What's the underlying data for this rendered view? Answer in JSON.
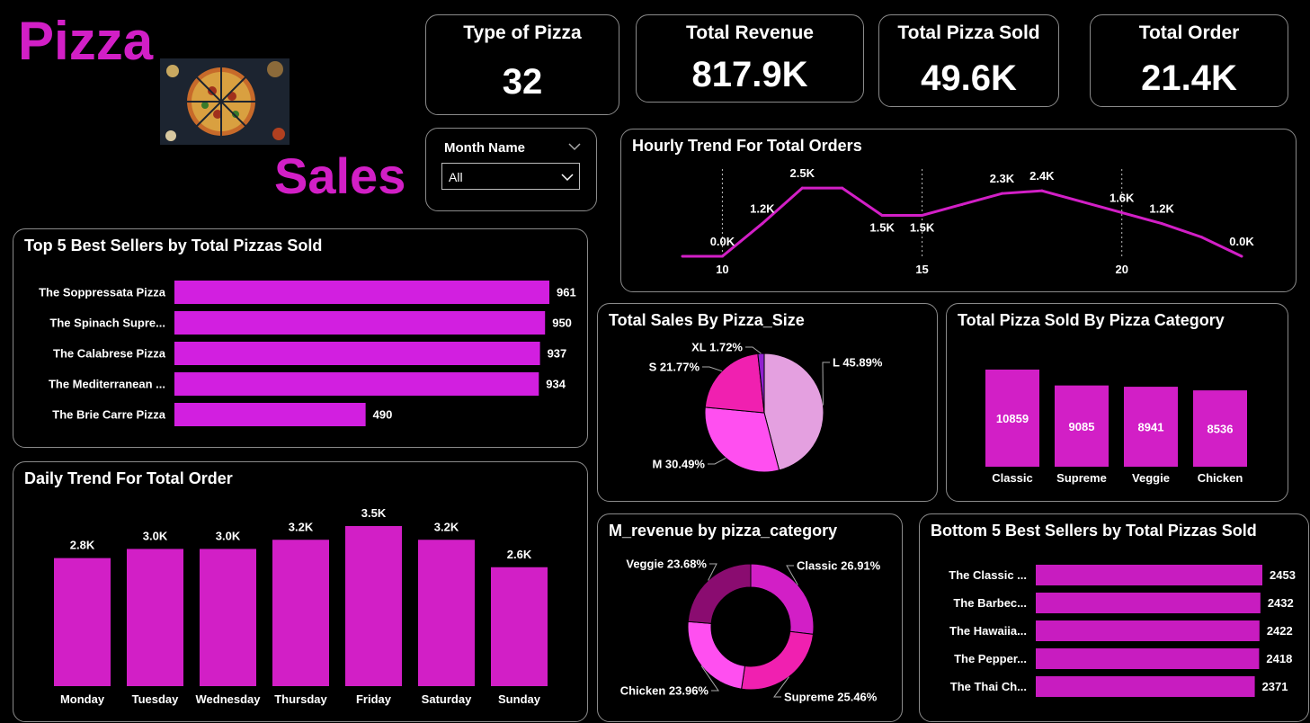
{
  "brand": {
    "title": "Pizza",
    "subtitle": "Sales",
    "image_icon": "pizza-photo"
  },
  "colors": {
    "background": "#000000",
    "accent": "#d21fc6",
    "border": "#8a8a8a"
  },
  "kpis": [
    {
      "title": "Type of Pizza",
      "value": "32"
    },
    {
      "title": "Total Revenue",
      "value": "817.9K"
    },
    {
      "title": "Total Pizza Sold",
      "value": "49.6K"
    },
    {
      "title": "Total Order",
      "value": "21.4K"
    }
  ],
  "slicer": {
    "label": "Month Name",
    "value": "All",
    "icon": "chevron-down-icon"
  },
  "chart_data": [
    {
      "id": "hourly",
      "type": "line",
      "title": "Hourly Trend For Total Orders",
      "x": [
        9,
        10,
        11,
        12,
        13,
        14,
        15,
        16,
        17,
        18,
        19,
        20,
        21,
        22,
        23
      ],
      "values": [
        0.0,
        0.0,
        1.2,
        2.5,
        2.5,
        1.5,
        1.5,
        1.9,
        2.3,
        2.4,
        2.0,
        1.6,
        1.2,
        0.7,
        0.0
      ],
      "labels": [
        {
          "i": 1,
          "text": "0.0K"
        },
        {
          "i": 2,
          "text": "1.2K"
        },
        {
          "i": 3,
          "text": "2.5K"
        },
        {
          "i": 5,
          "text": "1.5K"
        },
        {
          "i": 6,
          "text": "1.5K"
        },
        {
          "i": 8,
          "text": "2.3K"
        },
        {
          "i": 9,
          "text": "2.4K"
        },
        {
          "i": 11,
          "text": "1.6K"
        },
        {
          "i": 12,
          "text": "1.2K"
        },
        {
          "i": 14,
          "text": "0.0K"
        }
      ],
      "xticks": [
        10,
        15,
        20
      ],
      "ylim": [
        0,
        2.8
      ],
      "color": "#d21fc6"
    },
    {
      "id": "top5",
      "type": "bar",
      "orientation": "horizontal",
      "title": "Top 5 Best Sellers by Total Pizzas Sold",
      "categories": [
        "The Soppressata Pizza",
        "The Spinach Supre...",
        "The Calabrese Pizza",
        "The Mediterranean ...",
        "The Brie Carre Pizza"
      ],
      "values": [
        961,
        950,
        937,
        934,
        490
      ],
      "xlim": [
        0,
        961
      ],
      "color": "#d21fe0"
    },
    {
      "id": "daily",
      "type": "bar",
      "title": "Daily Trend For Total Order",
      "categories": [
        "Monday",
        "Tuesday",
        "Wednesday",
        "Thursday",
        "Friday",
        "Saturday",
        "Sunday"
      ],
      "values": [
        2.8,
        3.0,
        3.0,
        3.2,
        3.5,
        3.2,
        2.6
      ],
      "value_labels": [
        "2.8K",
        "3.0K",
        "3.0K",
        "3.2K",
        "3.5K",
        "3.2K",
        "2.6K"
      ],
      "ylim": [
        0,
        3.5
      ],
      "color": "#d21fc6"
    },
    {
      "id": "size",
      "type": "pie",
      "title": "Total Sales By Pizza_Size",
      "categories": [
        "L",
        "M",
        "S",
        "XL"
      ],
      "values": [
        45.89,
        30.49,
        21.77,
        1.72
      ],
      "labels": [
        "L 45.89%",
        "M 30.49%",
        "S 21.77%",
        "XL 1.72%"
      ],
      "colors": [
        "#e4a0e0",
        "#ff4ff0",
        "#f020b0",
        "#9020d0"
      ]
    },
    {
      "id": "category",
      "type": "bar",
      "title": "Total Pizza Sold By Pizza Category",
      "categories": [
        "Classic",
        "Supreme",
        "Veggie",
        "Chicken"
      ],
      "values": [
        10859,
        9085,
        8941,
        8536
      ],
      "ylim": [
        0,
        10859
      ],
      "color": "#d21fc6"
    },
    {
      "id": "revenue",
      "type": "pie",
      "title": "M_revenue by pizza_category",
      "categories": [
        "Classic",
        "Supreme",
        "Chicken",
        "Veggie"
      ],
      "values": [
        26.91,
        25.46,
        23.96,
        23.68
      ],
      "labels": [
        "Classic 26.91%",
        "Supreme 25.46%",
        "Chicken 23.96%",
        "Veggie 23.68%"
      ],
      "colors": [
        "#d21fc6",
        "#f020b0",
        "#ff4ff0",
        "#8a0c70"
      ]
    },
    {
      "id": "bottom5",
      "type": "bar",
      "orientation": "horizontal",
      "title": "Bottom 5 Best Sellers by Total Pizzas Sold",
      "categories": [
        "The Classic ...",
        "The Barbec...",
        "The Hawaiia...",
        "The Pepper...",
        "The Thai Ch..."
      ],
      "values": [
        2453,
        2432,
        2422,
        2418,
        2371
      ],
      "xlim": [
        0,
        2453
      ],
      "color": "#c81cc0"
    }
  ]
}
